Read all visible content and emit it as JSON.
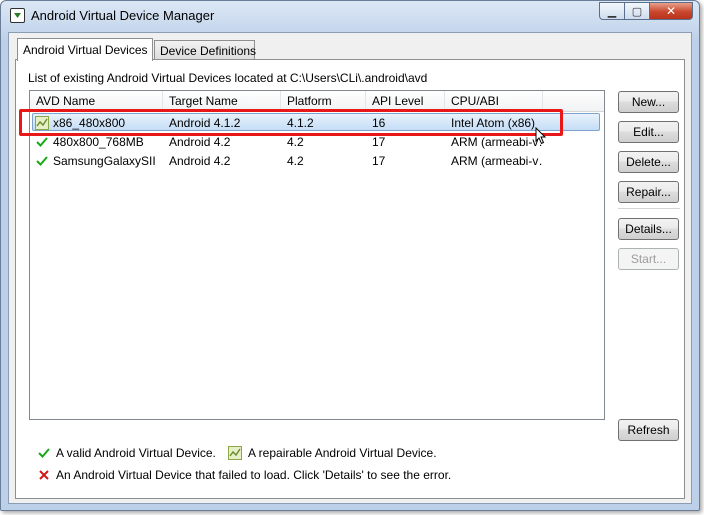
{
  "window": {
    "title": "Android Virtual Device Manager",
    "minimize_glyph": "▁",
    "maximize_glyph": "▢",
    "close_glyph": "✕"
  },
  "tabs": [
    {
      "label": "Android Virtual Devices",
      "active": true
    },
    {
      "label": "Device Definitions",
      "active": false
    }
  ],
  "list_label": "List of existing Android Virtual Devices located at C:\\Users\\CLi\\.android\\avd",
  "table": {
    "columns": [
      "AVD Name",
      "Target Name",
      "Platform",
      "API Level",
      "CPU/ABI"
    ],
    "rows": [
      {
        "status_icon": "repairable-icon",
        "name": "x86_480x800",
        "target": "Android 4.1.2",
        "platform": "4.1.2",
        "api": "16",
        "cpu": "Intel Atom (x86)",
        "selected": true
      },
      {
        "status_icon": "valid-check-icon",
        "name": "480x800_768MB",
        "target": "Android 4.2",
        "platform": "4.2",
        "api": "17",
        "cpu": "ARM (armeabi-v…",
        "selected": false
      },
      {
        "status_icon": "valid-check-icon",
        "name": "SamsungGalaxySII",
        "target": "Android 4.2",
        "platform": "4.2",
        "api": "17",
        "cpu": "ARM (armeabi-v…",
        "selected": false
      }
    ]
  },
  "buttons": {
    "new": "New...",
    "edit": "Edit...",
    "delete": "Delete...",
    "repair": "Repair...",
    "details": "Details...",
    "start": "Start...",
    "refresh": "Refresh"
  },
  "legend": {
    "valid": "A valid Android Virtual Device.",
    "repairable": "A repairable Android Virtual Device.",
    "failed": "An Android Virtual Device that failed to load. Click 'Details' to see the error."
  },
  "colors": {
    "valid_check": "#1aa81a",
    "failed_x": "#d01818",
    "highlight_box": "#e81818"
  }
}
